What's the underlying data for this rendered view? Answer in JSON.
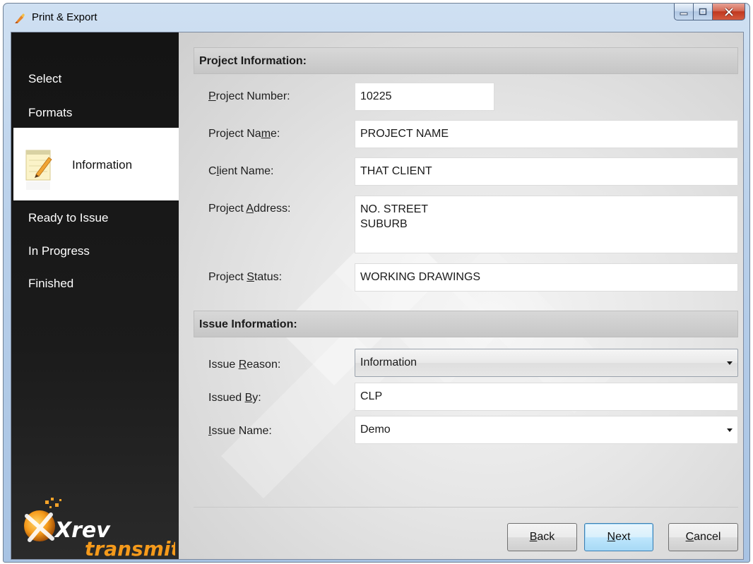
{
  "window": {
    "title": "Print & Export"
  },
  "sidebar": {
    "items": [
      {
        "label": "Select",
        "active": false
      },
      {
        "label": "Formats",
        "active": false
      },
      {
        "label": "Information",
        "active": true
      },
      {
        "label": "Ready to Issue",
        "active": false
      },
      {
        "label": "In Progress",
        "active": false
      },
      {
        "label": "Finished",
        "active": false
      }
    ],
    "logo_text_top": "Xrev",
    "logo_text_bottom": "transmit"
  },
  "project_info": {
    "header": "Project Information:",
    "project_number": {
      "label_prefix": "",
      "label_key": "P",
      "label_rest": "roject Number:",
      "value": "10225"
    },
    "project_name": {
      "label_prefix": "Project Na",
      "label_key": "m",
      "label_rest": "e:",
      "value": "PROJECT NAME"
    },
    "client_name": {
      "label_prefix": "C",
      "label_key": "l",
      "label_rest": "ient Name:",
      "value": "THAT CLIENT"
    },
    "project_address": {
      "label_prefix": "Project ",
      "label_key": "A",
      "label_rest": "ddress:",
      "line1": "NO. STREET",
      "line2": "SUBURB"
    },
    "project_status": {
      "label_prefix": "Project ",
      "label_key": "S",
      "label_rest": "tatus:",
      "value": "WORKING DRAWINGS"
    }
  },
  "issue_info": {
    "header": "Issue Information:",
    "issue_reason": {
      "label_prefix": "Issue ",
      "label_key": "R",
      "label_rest": "eason:",
      "value": "Information"
    },
    "issued_by": {
      "label_prefix": "Issued ",
      "label_key": "B",
      "label_rest": "y:",
      "value": "CLP"
    },
    "issue_name": {
      "label_prefix": "",
      "label_key": "I",
      "label_rest": "ssue Name:",
      "value": "Demo"
    }
  },
  "buttons": {
    "back": {
      "key": "B",
      "rest": "ack"
    },
    "next": {
      "key": "N",
      "rest": "ext"
    },
    "cancel": {
      "key": "C",
      "rest": "ancel"
    }
  },
  "colors": {
    "sidebar_bg": "#1b1b1b",
    "accent_next": "#3c7fb1",
    "close_red": "#c0381f"
  },
  "icons": {
    "app": "paint-brush-icon",
    "active_step": "notepad-pencil-icon",
    "minimize": "minimize-icon",
    "maximize": "maximize-icon",
    "close": "close-icon",
    "dropdown": "chevron-down-icon"
  }
}
